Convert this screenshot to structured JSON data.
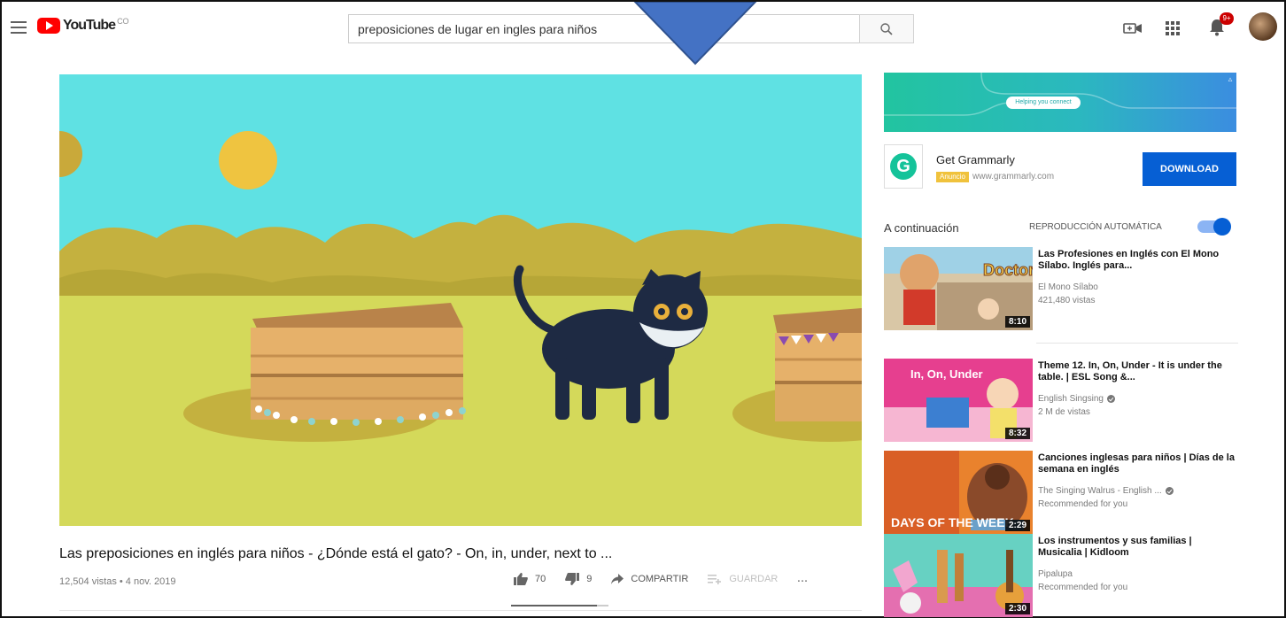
{
  "header": {
    "logo_text": "YouTube",
    "logo_country": "CO",
    "search_value": "preposiciones de lugar en ingles para niños",
    "notifications_count": "9+"
  },
  "video": {
    "title": "Las preposiciones en inglés para niños - ¿Dónde está el gato? - On, in, under, next to ...",
    "meta": "12,504 vistas • 4 nov. 2019",
    "likes": "70",
    "dislikes": "9",
    "share_label": "COMPARTIR",
    "save_label": "GUARDAR",
    "more_label": "...",
    "like_ratio": 0.886
  },
  "ad": {
    "banner_text": "Helping you connect",
    "title": "Get Grammarly",
    "tag": "Anuncio",
    "url": "www.grammarly.com",
    "button": "DOWNLOAD"
  },
  "sidebar": {
    "up_next": "A continuación",
    "autoplay_label": "REPRODUCCIÓN AUTOMÁTICA",
    "autoplay_on": true,
    "items": [
      {
        "title": "Las Profesiones en Inglés con El Mono Sílabo. Inglés para...",
        "channel": "El Mono Sílabo",
        "views": "421,480 vistas",
        "duration": "8:10",
        "verified": false,
        "thumb_text": "Doctor"
      },
      {
        "title": "Theme 12. In, On, Under - It is under the table. | ESL Song &...",
        "channel": "English Singsing",
        "views": "2 M de vistas",
        "duration": "8:32",
        "verified": true,
        "thumb_text": "In, On, Under"
      },
      {
        "title": "Canciones inglesas para niños | Días de la semana en inglés",
        "channel": "The Singing Walrus - English ...",
        "views": "Recommended for you",
        "duration": "2:29",
        "verified": true,
        "thumb_text": "DAYS OF THE WEEK"
      },
      {
        "title": "Los instrumentos y sus familias | Musicalia | Kidloom",
        "channel": "Pipalupa",
        "views": "Recommended for you",
        "duration": "2:30",
        "verified": false,
        "thumb_text": ""
      }
    ]
  },
  "colors": {
    "youtube_red": "#ff0000",
    "blue": "#065fd4",
    "grammarly_green": "#15c39a",
    "arrow_fill": "#4472c4",
    "arrow_stroke": "#2f528f"
  },
  "icons": [
    "menu-icon",
    "youtube-logo-icon",
    "search-icon",
    "create-video-icon",
    "apps-grid-icon",
    "bell-icon",
    "like-icon",
    "dislike-icon",
    "share-icon",
    "save-icon",
    "more-icon",
    "verified-check-icon"
  ]
}
